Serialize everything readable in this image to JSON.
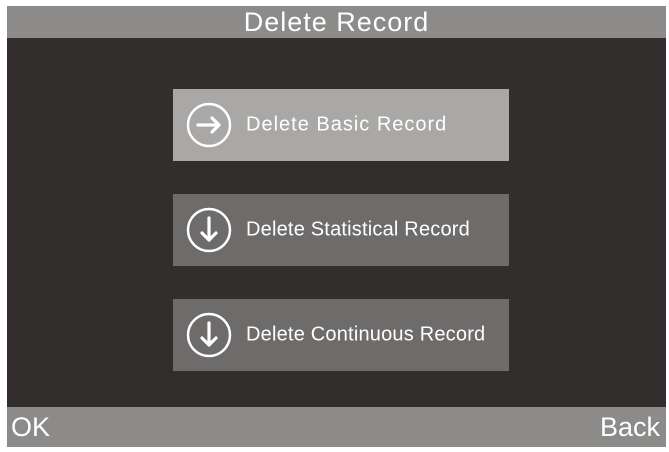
{
  "header": {
    "title": "Delete Record"
  },
  "menu": {
    "items": [
      {
        "label": "Delete Basic Record",
        "icon": "arrow-right-circle-icon",
        "selected": true
      },
      {
        "label": "Delete Statistical Record",
        "icon": "arrow-down-circle-icon",
        "selected": false
      },
      {
        "label": "Delete Continuous Record",
        "icon": "arrow-down-circle-icon",
        "selected": false
      }
    ]
  },
  "footer": {
    "left_key": "OK",
    "right_key": "Back"
  },
  "colors": {
    "background": "#312e2d",
    "bar": "#8c8b8a",
    "button": "#6e6c6b",
    "button_selected": "#a9a8a7",
    "text": "#ffffff"
  }
}
